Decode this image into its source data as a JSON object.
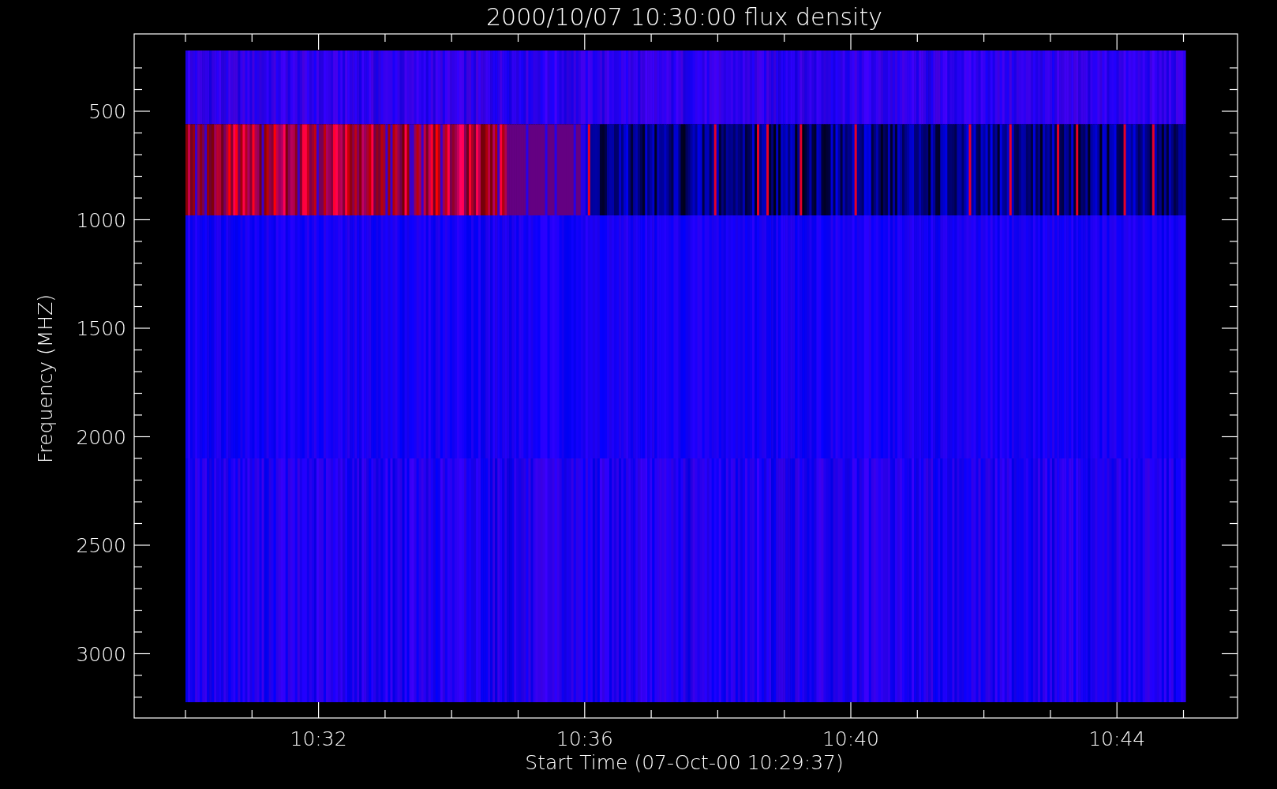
{
  "title": "2000/10/07 10:30:00 flux density",
  "y_axis": {
    "label": "Frequency (MHZ)",
    "ticks": [
      "500",
      "1000",
      "1500",
      "2000",
      "2500",
      "3000"
    ]
  },
  "x_axis": {
    "label": "Start Time (07-Oct-00 10:29:37)",
    "ticks": [
      "10:32",
      "10:36",
      "10:40",
      "10:44"
    ]
  }
}
